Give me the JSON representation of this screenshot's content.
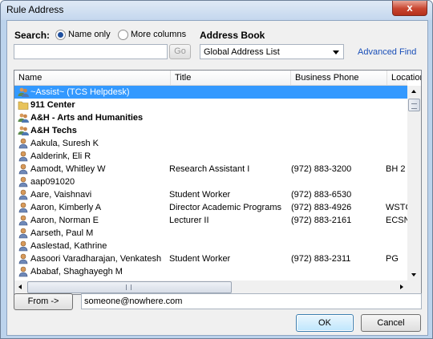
{
  "window": {
    "title": "Rule Address",
    "close_glyph": "x"
  },
  "search": {
    "label": "Search:",
    "option_name": "Name only",
    "option_more": "More columns",
    "selected": "Name only",
    "value": "",
    "go_label": "Go"
  },
  "address_book": {
    "label": "Address Book",
    "selected": "Global Address List",
    "advanced_find": "Advanced Find"
  },
  "columns": [
    "Name",
    "Title",
    "Business Phone",
    "Location"
  ],
  "rows": [
    {
      "name": "~Assist~ (TCS Helpdesk)",
      "title": "",
      "phone": "",
      "location": "",
      "icon": "distribution-list-icon",
      "bold": false,
      "selected": true
    },
    {
      "name": "911 Center",
      "title": "",
      "phone": "",
      "location": "",
      "icon": "folder-icon",
      "bold": true,
      "selected": false
    },
    {
      "name": "A&H - Arts and Humanities",
      "title": "",
      "phone": "",
      "location": "",
      "icon": "group-icon",
      "bold": true,
      "selected": false
    },
    {
      "name": "A&H Techs",
      "title": "",
      "phone": "",
      "location": "",
      "icon": "group-icon",
      "bold": true,
      "selected": false
    },
    {
      "name": "Aakula, Suresh K",
      "title": "",
      "phone": "",
      "location": "",
      "icon": "contact-icon",
      "bold": false,
      "selected": false
    },
    {
      "name": "Aalderink, Eli R",
      "title": "",
      "phone": "",
      "location": "",
      "icon": "contact-icon",
      "bold": false,
      "selected": false
    },
    {
      "name": "Aamodt, Whitley W",
      "title": "Research Assistant I",
      "phone": "(972) 883-3200",
      "location": "BH 2",
      "icon": "contact-icon",
      "bold": false,
      "selected": false
    },
    {
      "name": "aap091020",
      "title": "",
      "phone": "",
      "location": "",
      "icon": "contact-icon",
      "bold": false,
      "selected": false
    },
    {
      "name": "Aare, Vaishnavi",
      "title": "Student Worker",
      "phone": "(972) 883-6530",
      "location": "",
      "icon": "contact-icon",
      "bold": false,
      "selected": false
    },
    {
      "name": "Aaron, Kimberly A",
      "title": "Director Academic Programs",
      "phone": "(972) 883-4926",
      "location": "WSTC",
      "icon": "contact-icon",
      "bold": false,
      "selected": false
    },
    {
      "name": "Aaron, Norman E",
      "title": "Lecturer II",
      "phone": "(972) 883-2161",
      "location": "ECSN",
      "icon": "contact-icon",
      "bold": false,
      "selected": false
    },
    {
      "name": "Aarseth, Paul M",
      "title": "",
      "phone": "",
      "location": "",
      "icon": "contact-icon",
      "bold": false,
      "selected": false
    },
    {
      "name": "Aaslestad, Kathrine",
      "title": "",
      "phone": "",
      "location": "",
      "icon": "contact-icon",
      "bold": false,
      "selected": false
    },
    {
      "name": "Aasoori Varadharajan, Venkatesh",
      "title": "Student Worker",
      "phone": "(972) 883-2311",
      "location": "PG",
      "icon": "contact-icon",
      "bold": false,
      "selected": false
    },
    {
      "name": "Ababaf, Shaghayegh M",
      "title": "",
      "phone": "",
      "location": "",
      "icon": "contact-icon",
      "bold": false,
      "selected": false
    }
  ],
  "from_button": "From ->",
  "from_value": "someone@nowhere.com",
  "ok_label": "OK",
  "cancel_label": "Cancel",
  "colors": {
    "selection": "#3399ff",
    "link": "#1a4fb8",
    "window_frame": "#bcd3ec"
  }
}
